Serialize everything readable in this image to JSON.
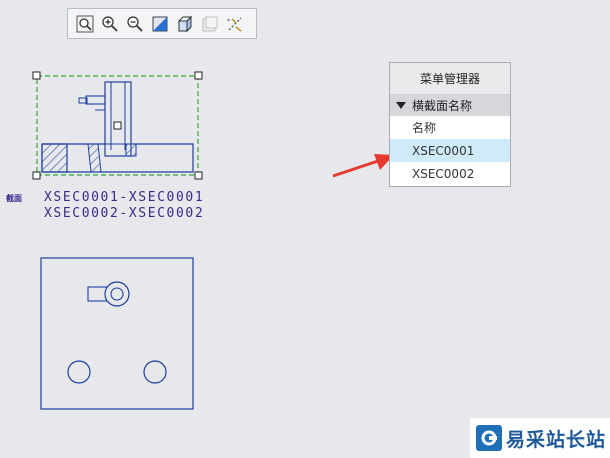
{
  "toolbar": {
    "buttons": [
      {
        "name": "zoom-fit-icon",
        "disabled": false
      },
      {
        "name": "zoom-in-icon",
        "disabled": false
      },
      {
        "name": "zoom-out-icon",
        "disabled": false
      },
      {
        "name": "shading-icon",
        "disabled": false
      },
      {
        "name": "view-cube-icon",
        "disabled": false
      },
      {
        "name": "display-style-icon",
        "disabled": true
      },
      {
        "name": "datum-display-icon",
        "disabled": false
      }
    ]
  },
  "drawing": {
    "section_caption": "截面",
    "section_line1": "XSEC0001-XSEC0001",
    "section_line2": "XSEC0002-XSEC0002"
  },
  "menu": {
    "title": "菜单管理器",
    "group_label": "横截面名称",
    "items": [
      {
        "label": "名称",
        "selected": false
      },
      {
        "label": "XSEC0001",
        "selected": true
      },
      {
        "label": "XSEC0002",
        "selected": false
      }
    ]
  },
  "watermark": {
    "text": "易采站长站"
  },
  "colors": {
    "geometry": "#1f3fa0",
    "selection": "#2fa82f",
    "arrow": "#e8392f",
    "highlight": "#cfeaf8"
  }
}
